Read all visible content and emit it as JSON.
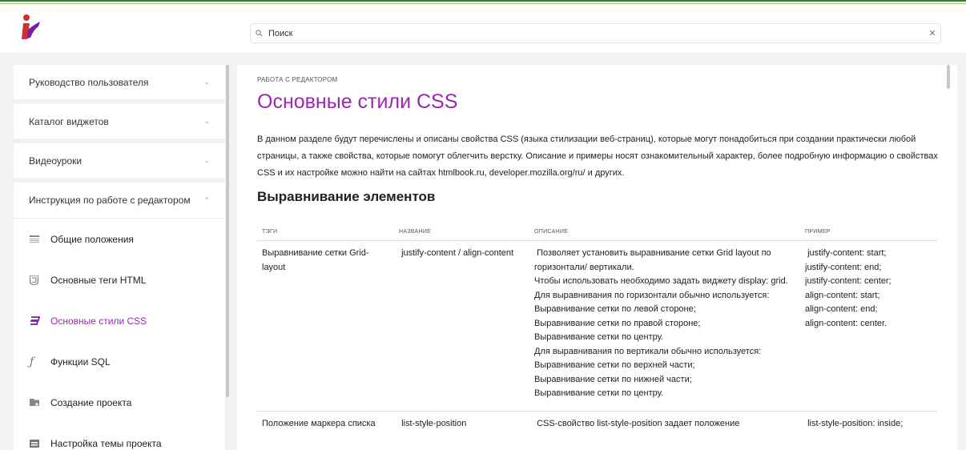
{
  "search": {
    "placeholder": "Поиск",
    "value": "Поиск"
  },
  "sidebar": {
    "sections": [
      {
        "label": "Руководство пользователя"
      },
      {
        "label": "Каталог виджетов"
      },
      {
        "label": "Видеоуроки"
      },
      {
        "label": "Инструкция по работе с редактором"
      }
    ],
    "items": [
      {
        "label": "Общие положения",
        "icon": "document-lines-icon"
      },
      {
        "label": "Основные теги HTML",
        "icon": "html5-icon"
      },
      {
        "label": "Основные стили CSS",
        "icon": "css3-icon"
      },
      {
        "label": "Функции SQL",
        "icon": "function-icon"
      },
      {
        "label": "Создание проекта",
        "icon": "folder-add-icon"
      },
      {
        "label": "Настройка темы проекта",
        "icon": "theme-icon"
      }
    ]
  },
  "page": {
    "breadcrumb": "РАБОТА С РЕДАКТОРОМ",
    "title": "Основные стили CSS",
    "intro": "В данном разделе будут перечислены и описаны свойства CSS (языка стилизации веб-страниц), которые могут понадобиться при создании практически любой страницы, а также свойства, которые помогут облегчить верстку. Описание и примеры носят ознакомительный характер, более подробную информацию о свойствах CSS и их настройке можно найти на сайтах htmlbook.ru, developer.mozilla.org/ru/ и других.",
    "section_title": "Выравнивание элементов"
  },
  "table": {
    "headers": [
      "ТЭГИ",
      "НАЗВАНИЕ",
      "ОПИСАНИЕ",
      "ПРИМЕР"
    ],
    "rows": [
      {
        "tag": "Выравнивание сетки Grid-layout",
        "name": " justify-content / align-content",
        "desc": " Позволяет установить выравнивание сетки Grid layout по горизонтали/ вертикали.\nЧтобы использовать необходимо задать виджету display: grid.\nДля выравнивания по горизонтали обычно используется:\nВыравнивание сетки по левой стороне;\nВыравнивание сетки по правой стороне;\nВыравнивание сетки по центру.\nДля выравнивания по вертикали обычно используется:\nВыравнивание сетки по верхней части;\nВыравнивание сетки по нижней части;\nВыравнивание сетки по центру.",
        "example": " justify-content: start;\njustify-content: end;\njustify-content: center;\nalign-content: start;\nalign-content: end;\nalign-content: center."
      },
      {
        "tag": "Положение маркера списка",
        "name": " list-style-position",
        "desc": " CSS-свойство list-style-position задает положение",
        "example": " list-style-position: inside;"
      }
    ]
  },
  "colors": {
    "accent": "#9c27b0",
    "logo_red": "#d32f2f",
    "logo_purple": "#7b1fa2"
  }
}
